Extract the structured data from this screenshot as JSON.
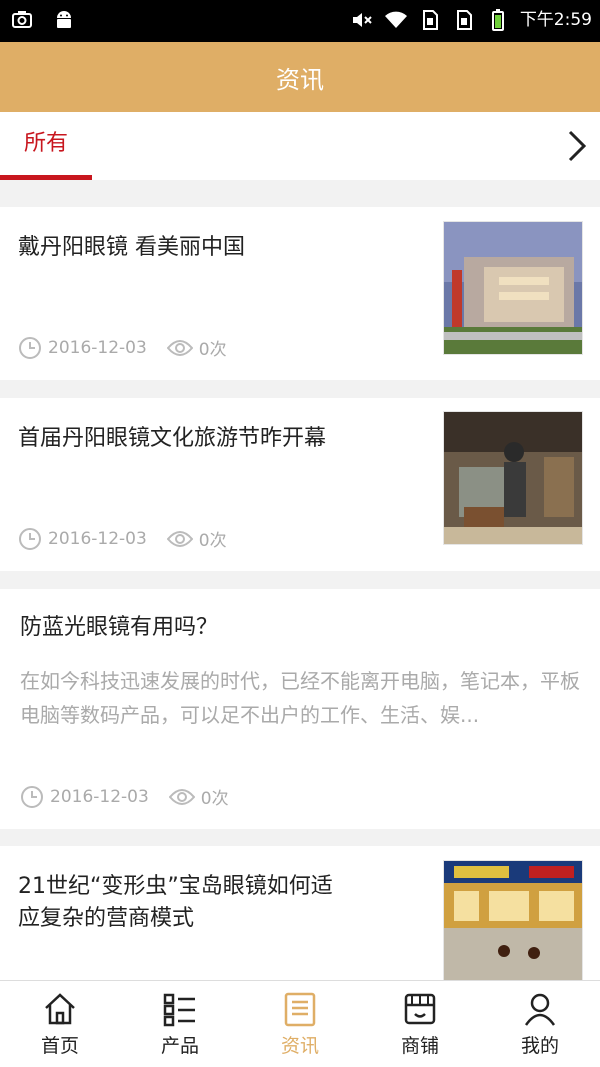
{
  "status_bar": {
    "time": "下午2:59",
    "icons": [
      "screenshot-icon",
      "android-icon",
      "mute-icon",
      "wifi-icon",
      "sim1-icon",
      "sim2-icon",
      "battery-icon"
    ]
  },
  "header": {
    "title": "资讯"
  },
  "tabs": {
    "all_label": "所有",
    "more_icon": "chevron-right-icon"
  },
  "news": [
    {
      "title": "戴丹阳眼镜 看美丽中国",
      "date": "2016-12-03",
      "views": "0次"
    },
    {
      "title": "首届丹阳眼镜文化旅游节昨开幕",
      "date": "2016-12-03",
      "views": "0次"
    },
    {
      "title": "防蓝光眼镜有用吗？",
      "summary": "在如今科技迅速发展的时代，已经不能离开电脑，笔记本，平板电脑等数码产品，可以足不出户的工作、生活、娱...",
      "date": "2016-12-03",
      "views": "0次"
    },
    {
      "title_line1": "21世纪“变形虫”宝岛眼镜如何适",
      "title_line2": "应复杂的营商模式"
    }
  ],
  "bottom_nav": [
    {
      "label": "首页",
      "icon": "home-icon"
    },
    {
      "label": "产品",
      "icon": "product-list-icon"
    },
    {
      "label": "资讯",
      "icon": "news-icon"
    },
    {
      "label": "商铺",
      "icon": "store-icon"
    },
    {
      "label": "我的",
      "icon": "user-icon"
    }
  ],
  "colors": {
    "accent": "#dfae66",
    "active_tab": "#c8161e",
    "meta_text": "#aaaaaa"
  }
}
